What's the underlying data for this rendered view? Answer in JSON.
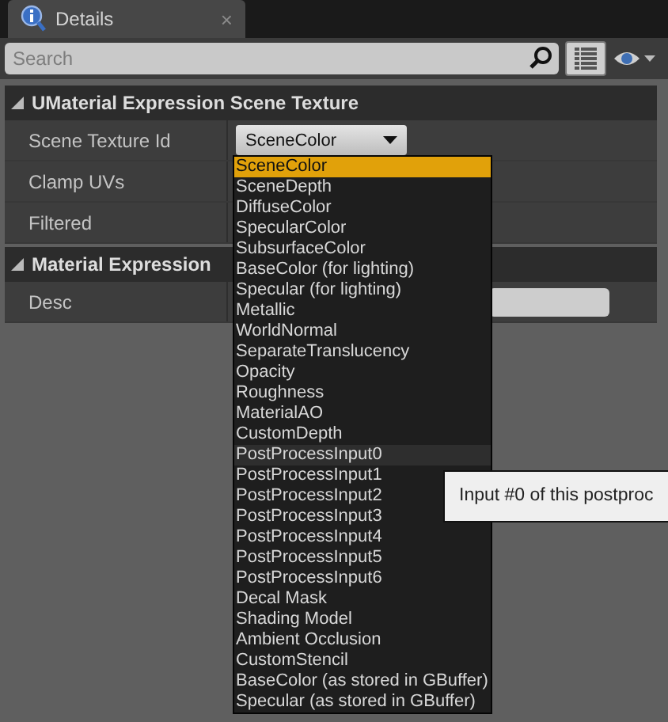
{
  "tab": {
    "title": "Details",
    "close": "×"
  },
  "search": {
    "placeholder": "Search"
  },
  "sections": [
    {
      "title": "UMaterial Expression Scene Texture",
      "expanded": true,
      "rows": [
        {
          "label": "Scene Texture Id",
          "kind": "combo",
          "value": "SceneColor"
        },
        {
          "label": "Clamp UVs",
          "kind": "plain"
        },
        {
          "label": "Filtered",
          "kind": "plain"
        }
      ]
    },
    {
      "title": "Material Expression",
      "expanded": true,
      "rows": [
        {
          "label": "Desc",
          "kind": "text"
        }
      ]
    }
  ],
  "dropdown": {
    "items": [
      {
        "label": "SceneColor",
        "selected": true,
        "hovered": false
      },
      {
        "label": "SceneDepth",
        "selected": false,
        "hovered": false
      },
      {
        "label": "DiffuseColor",
        "selected": false,
        "hovered": false
      },
      {
        "label": "SpecularColor",
        "selected": false,
        "hovered": false
      },
      {
        "label": "SubsurfaceColor",
        "selected": false,
        "hovered": false
      },
      {
        "label": "BaseColor (for lighting)",
        "selected": false,
        "hovered": false
      },
      {
        "label": "Specular (for lighting)",
        "selected": false,
        "hovered": false
      },
      {
        "label": "Metallic",
        "selected": false,
        "hovered": false
      },
      {
        "label": "WorldNormal",
        "selected": false,
        "hovered": false
      },
      {
        "label": "SeparateTranslucency",
        "selected": false,
        "hovered": false
      },
      {
        "label": "Opacity",
        "selected": false,
        "hovered": false
      },
      {
        "label": "Roughness",
        "selected": false,
        "hovered": false
      },
      {
        "label": "MaterialAO",
        "selected": false,
        "hovered": false
      },
      {
        "label": "CustomDepth",
        "selected": false,
        "hovered": false
      },
      {
        "label": "PostProcessInput0",
        "selected": false,
        "hovered": true
      },
      {
        "label": "PostProcessInput1",
        "selected": false,
        "hovered": false
      },
      {
        "label": "PostProcessInput2",
        "selected": false,
        "hovered": false
      },
      {
        "label": "PostProcessInput3",
        "selected": false,
        "hovered": false
      },
      {
        "label": "PostProcessInput4",
        "selected": false,
        "hovered": false
      },
      {
        "label": "PostProcessInput5",
        "selected": false,
        "hovered": false
      },
      {
        "label": "PostProcessInput6",
        "selected": false,
        "hovered": false
      },
      {
        "label": "Decal Mask",
        "selected": false,
        "hovered": false
      },
      {
        "label": "Shading Model",
        "selected": false,
        "hovered": false
      },
      {
        "label": "Ambient Occlusion",
        "selected": false,
        "hovered": false
      },
      {
        "label": "CustomStencil",
        "selected": false,
        "hovered": false
      },
      {
        "label": "BaseColor (as stored in GBuffer)",
        "selected": false,
        "hovered": false
      },
      {
        "label": "Specular (as stored in GBuffer)",
        "selected": false,
        "hovered": false
      }
    ]
  },
  "tooltip": {
    "text": "Input #0 of this postproc"
  }
}
